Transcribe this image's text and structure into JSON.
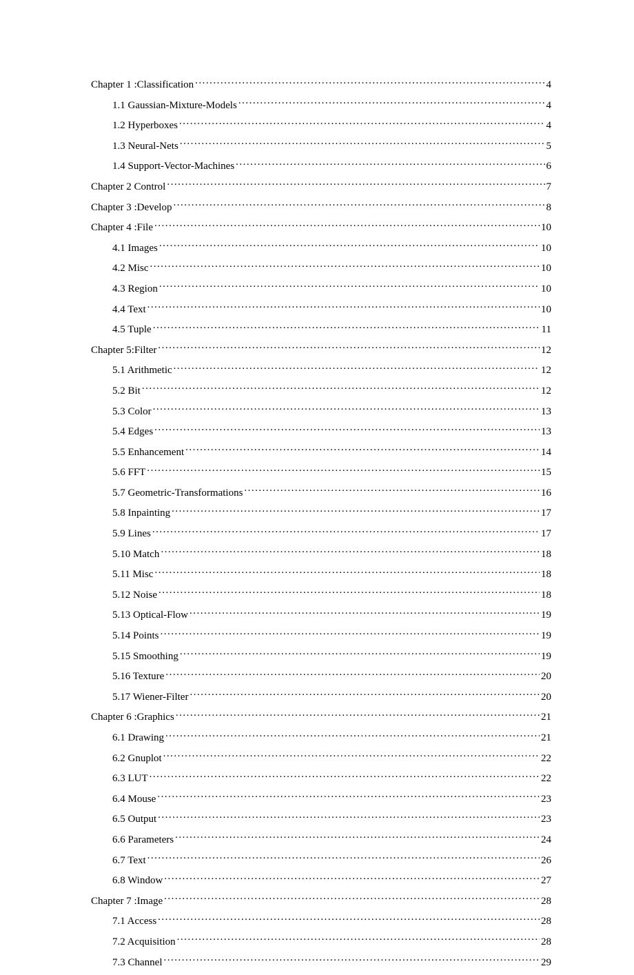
{
  "toc": [
    {
      "level": 1,
      "label": "Chapter 1 :Classification",
      "page": "4"
    },
    {
      "level": 2,
      "label": "1.1 Gaussian-Mixture-Models",
      "page": "4"
    },
    {
      "level": 2,
      "label": "1.2 Hyperboxes",
      "page": "4"
    },
    {
      "level": 2,
      "label": "1.3 Neural-Nets",
      "page": "5"
    },
    {
      "level": 2,
      "label": "1.4 Support-Vector-Machines",
      "page": "6"
    },
    {
      "level": 1,
      "label": "Chapter 2   Control",
      "page": "7"
    },
    {
      "level": 1,
      "label": "Chapter 3   :Develop",
      "page": "8"
    },
    {
      "level": 1,
      "label": "Chapter 4 :File",
      "page": "10"
    },
    {
      "level": 2,
      "label": "4.1 Images",
      "page": "10"
    },
    {
      "level": 2,
      "label": "4.2 Misc",
      "page": "10"
    },
    {
      "level": 2,
      "label": "4.3 Region",
      "page": "10"
    },
    {
      "level": 2,
      "label": "4.4 Text",
      "page": "10"
    },
    {
      "level": 2,
      "label": "4.5 Tuple",
      "page": "11"
    },
    {
      "level": 1,
      "label": "Chapter 5:Filter",
      "page": "12"
    },
    {
      "level": 2,
      "label": "5.1 Arithmetic",
      "page": "12"
    },
    {
      "level": 2,
      "label": "5.2 Bit",
      "page": "12"
    },
    {
      "level": 2,
      "label": "5.3 Color",
      "page": "13"
    },
    {
      "level": 2,
      "label": "5.4 Edges",
      "page": "13"
    },
    {
      "level": 2,
      "label": "5.5 Enhancement",
      "page": "14"
    },
    {
      "level": 2,
      "label": "5.6 FFT",
      "page": "15"
    },
    {
      "level": 2,
      "label": "5.7 Geometric-Transformations",
      "page": "16"
    },
    {
      "level": 2,
      "label": "5.8 Inpainting",
      "page": "17"
    },
    {
      "level": 2,
      "label": "5.9 Lines",
      "page": "17"
    },
    {
      "level": 2,
      "label": "5.10 Match",
      "page": "18"
    },
    {
      "level": 2,
      "label": "5.11 Misc",
      "page": "18"
    },
    {
      "level": 2,
      "label": "5.12 Noise",
      "page": "18"
    },
    {
      "level": 2,
      "label": "5.13 Optical-Flow",
      "page": "19"
    },
    {
      "level": 2,
      "label": "5.14 Points",
      "page": "19"
    },
    {
      "level": 2,
      "label": "5.15 Smoothing",
      "page": "19"
    },
    {
      "level": 2,
      "label": "5.16 Texture",
      "page": "20"
    },
    {
      "level": 2,
      "label": "5.17 Wiener-Filter",
      "page": "20"
    },
    {
      "level": 1,
      "label": "Chapter 6   :Graphics",
      "page": "21"
    },
    {
      "level": 2,
      "label": "6.1 Drawing",
      "page": "21"
    },
    {
      "level": 2,
      "label": "6.2 Gnuplot",
      "page": "22"
    },
    {
      "level": 2,
      "label": "6.3 LUT",
      "page": "22"
    },
    {
      "level": 2,
      "label": "6.4 Mouse",
      "page": "23"
    },
    {
      "level": 2,
      "label": "6.5 Output",
      "page": "23"
    },
    {
      "level": 2,
      "label": "6.6 Parameters",
      "page": "24"
    },
    {
      "level": 2,
      "label": "6.7 Text",
      "page": "26"
    },
    {
      "level": 2,
      "label": "6.8 Window",
      "page": "27"
    },
    {
      "level": 1,
      "label": "Chapter 7 :Image",
      "page": "28"
    },
    {
      "level": 2,
      "label": "7.1 Access",
      "page": "28"
    },
    {
      "level": 2,
      "label": "7.2 Acquisition",
      "page": "28"
    },
    {
      "level": 2,
      "label": "7.3 Channel",
      "page": "29"
    }
  ]
}
